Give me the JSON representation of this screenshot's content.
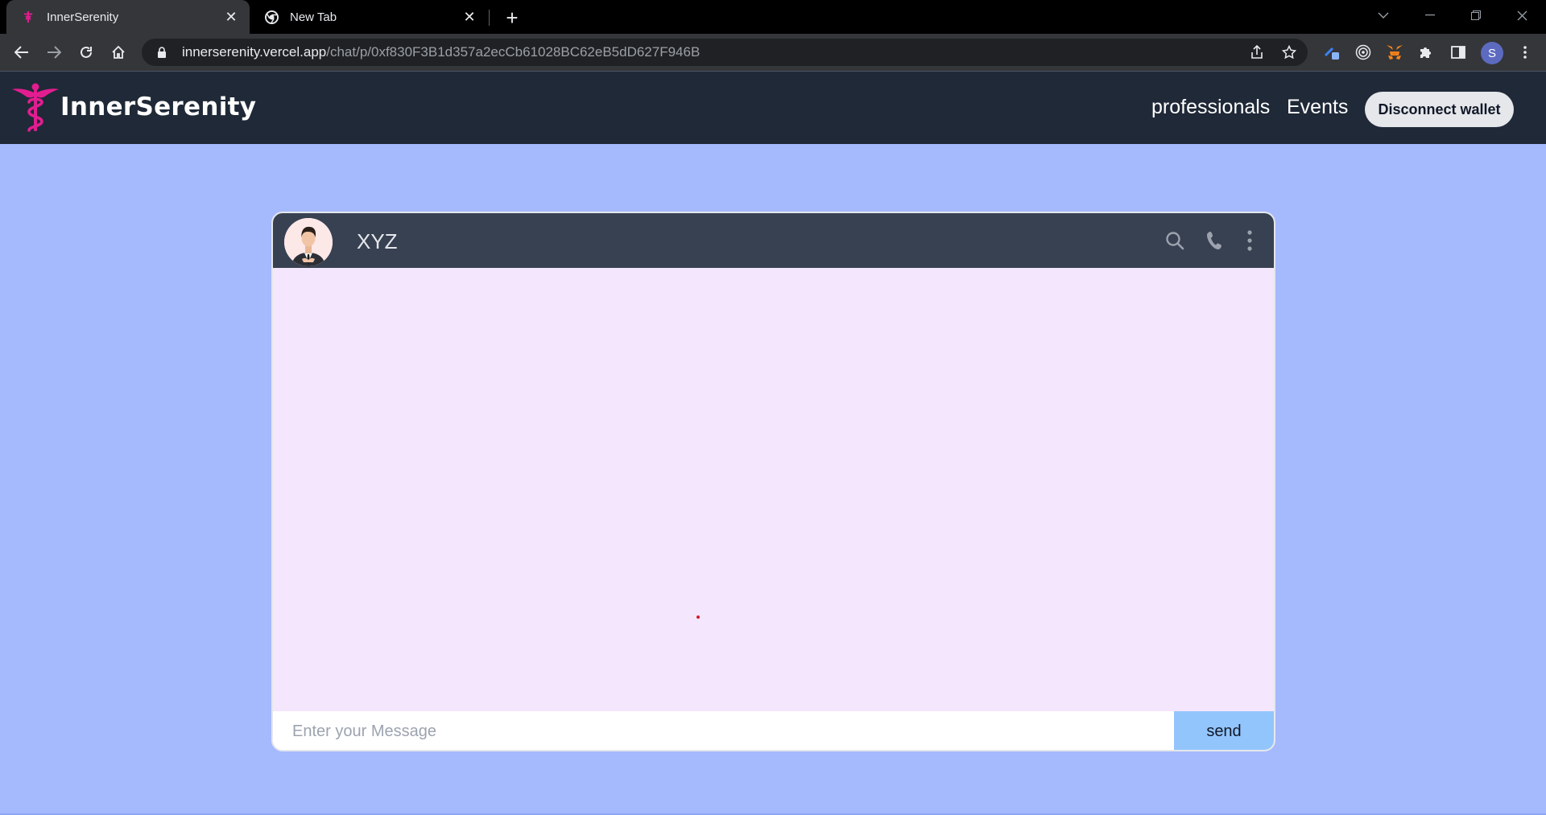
{
  "browser": {
    "tabs": [
      {
        "title": "InnerSerenity",
        "active": true,
        "icon": "caduceus-favicon"
      },
      {
        "title": "New Tab",
        "active": false,
        "icon": "chrome-icon"
      }
    ],
    "address": {
      "host": "innerserenity.vercel.app",
      "path": "/chat/p/0xf830F3B1d357a2ecCb61028BC62eB5dD627F946B"
    },
    "profile_initial": "S"
  },
  "site": {
    "brand": "InnerSerenity",
    "nav": {
      "professionals": "professionals",
      "events": "Events",
      "disconnect": "Disconnect wallet"
    }
  },
  "chat": {
    "contact_name": "XYZ",
    "composer": {
      "placeholder": "Enter your Message",
      "value": "",
      "send_label": "send"
    }
  },
  "colors": {
    "page_background": "#a5b9fd",
    "header_background": "#1f2937",
    "chat_header": "#374151",
    "chat_body": "#f4e6fd",
    "brand_accent": "#e11d8f",
    "send_button": "#93c5fd"
  }
}
